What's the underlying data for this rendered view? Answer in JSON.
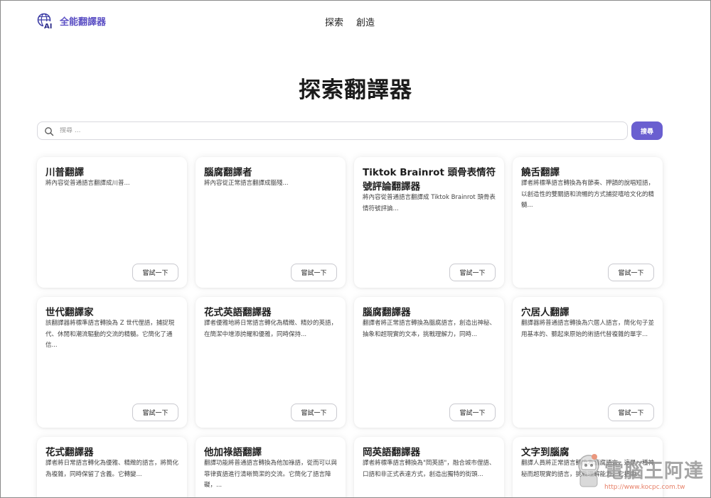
{
  "app": {
    "name": "全能翻譯器"
  },
  "nav": {
    "items": [
      "探索",
      "創造"
    ]
  },
  "page": {
    "title": "探索翻譯器"
  },
  "search": {
    "placeholder": "搜尋 ...",
    "button_label": "搜尋"
  },
  "card_button_label": "嘗試一下",
  "cards": [
    {
      "title": "川普翻譯",
      "desc": "將內容從普通語言翻譯成川普..."
    },
    {
      "title": "腦腐翻譯者",
      "desc": "將內容從正常語言翻譯成腦殘..."
    },
    {
      "title": "Tiktok Brainrot 頭骨表情符號評論翻譯器",
      "desc": "將內容從普通語言翻譯成 Tiktok Brainrot 頭骨表情符號評論..."
    },
    {
      "title": "饒舌翻譯",
      "desc": "譯者將標準語言轉換為有節奏、押韻的說唱短語，以創造性的雙關語和流暢的方式捕捉嘻哈文化的精髓..."
    },
    {
      "title": "世代翻譯家",
      "desc": "該翻譯器將標準語言轉換為 Z 世代俚語，捕捉現代、休閒和潮流驅動的交流的精髓。它簡化了通信..."
    },
    {
      "title": "花式英語翻譯器",
      "desc": "譯者優雅地將日常語言轉化為精緻、精妙的英語，在簡潔中增添誇耀和優雅，同時保持..."
    },
    {
      "title": "腦腐翻譯器",
      "desc": "翻譯者將正常語言轉換為腦腐語言，創造出神秘、抽象和超現實的文本，挑戰理解力，同時..."
    },
    {
      "title": "穴居人翻譯",
      "desc": "翻譯器將普通語言轉換為穴居人語言，簡化句子並用基本的、聽起來原始的術語代替複雜的單字..."
    },
    {
      "title": "花式翻譯器",
      "desc": "譯者將日常語言轉化為優雅、精緻的語言，將簡化為複雜，同時保留了含義。它轉變..."
    },
    {
      "title": "他加祿語翻譯",
      "desc": "翻譯功能將普通語言轉換為他加祿語，從而可以與菲律賓語進行清晰簡潔的交流。它簡化了語言障礙，..."
    },
    {
      "title": "岡英語翻譯器",
      "desc": "譯者將標準語言轉換為\"岡英語\"，融合城市俚語、口語和非正式表達方式，創造出獨特的街頭..."
    },
    {
      "title": "文字到腦腐",
      "desc": "翻譯人員將正常語言轉換為腦腐語言，這是一種神秘而超現實的語言，挑戰理解能力，它扭曲..."
    }
  ],
  "watermark": {
    "text": "電腦王阿達",
    "url": "http://www.kocpc.com.tw"
  },
  "colors": {
    "accent": "#6a5fd0",
    "brand_text": "#5b4fc4",
    "border": "#d8d8de"
  }
}
